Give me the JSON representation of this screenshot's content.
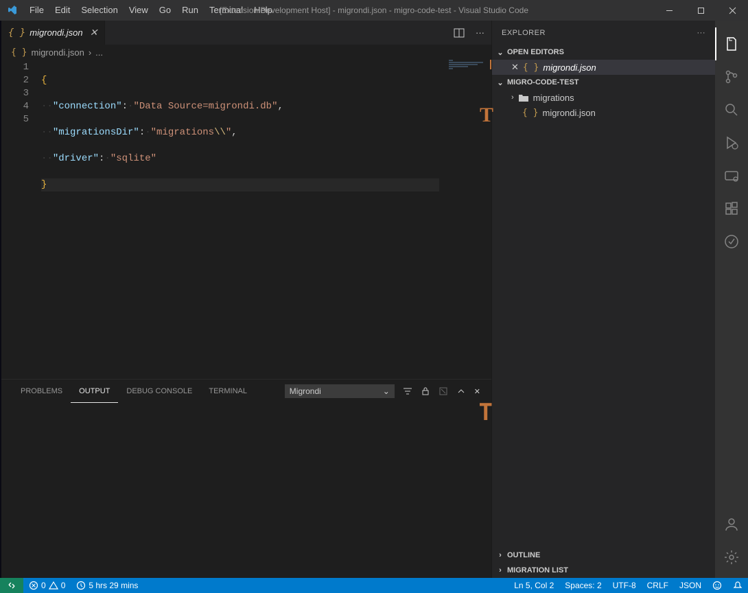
{
  "title": "[Extension Development Host] - migrondi.json - migro-code-test - Visual Studio Code",
  "menu": [
    "File",
    "Edit",
    "Selection",
    "View",
    "Go",
    "Run",
    "Terminal",
    "Help"
  ],
  "tab": {
    "filename": "migrondi.json"
  },
  "breadcrumb": {
    "filename": "migrondi.json",
    "sep": "›",
    "more": "..."
  },
  "editor": {
    "lineNumbers": [
      "1",
      "2",
      "3",
      "4",
      "5"
    ],
    "code": {
      "l1_brace_open": "{",
      "l2_key": "\"connection\"",
      "l2_val": "\"Data Source=migrondi.db\"",
      "l3_key": "\"migrationsDir\"",
      "l3_val_pre": "\"migrations",
      "l3_val_esc": "\\\\",
      "l3_val_post": "\"",
      "l4_key": "\"driver\"",
      "l4_val": "\"sqlite\"",
      "l5_brace_close": "}"
    }
  },
  "panel": {
    "tabs": [
      "PROBLEMS",
      "OUTPUT",
      "DEBUG CONSOLE",
      "TERMINAL"
    ],
    "activeTab": 1,
    "selectValue": "Migrondi",
    "overlayChar": "T"
  },
  "explorer": {
    "title": "EXPLORER",
    "sections": {
      "openEditors": "OPEN EDITORS",
      "project": "MIGRO-CODE-TEST",
      "outline": "OUTLINE",
      "migrationList": "MIGRATION LIST"
    },
    "openEditorItem": "migrondi.json",
    "tree": {
      "folder": "migrations",
      "file": "migrondi.json"
    },
    "overlayChar": "T"
  },
  "status": {
    "errors": "0",
    "warnings": "0",
    "time": "5 hrs 29 mins",
    "cursor": "Ln 5, Col 2",
    "spaces": "Spaces: 2",
    "encoding": "UTF-8",
    "eol": "CRLF",
    "lang": "JSON"
  }
}
